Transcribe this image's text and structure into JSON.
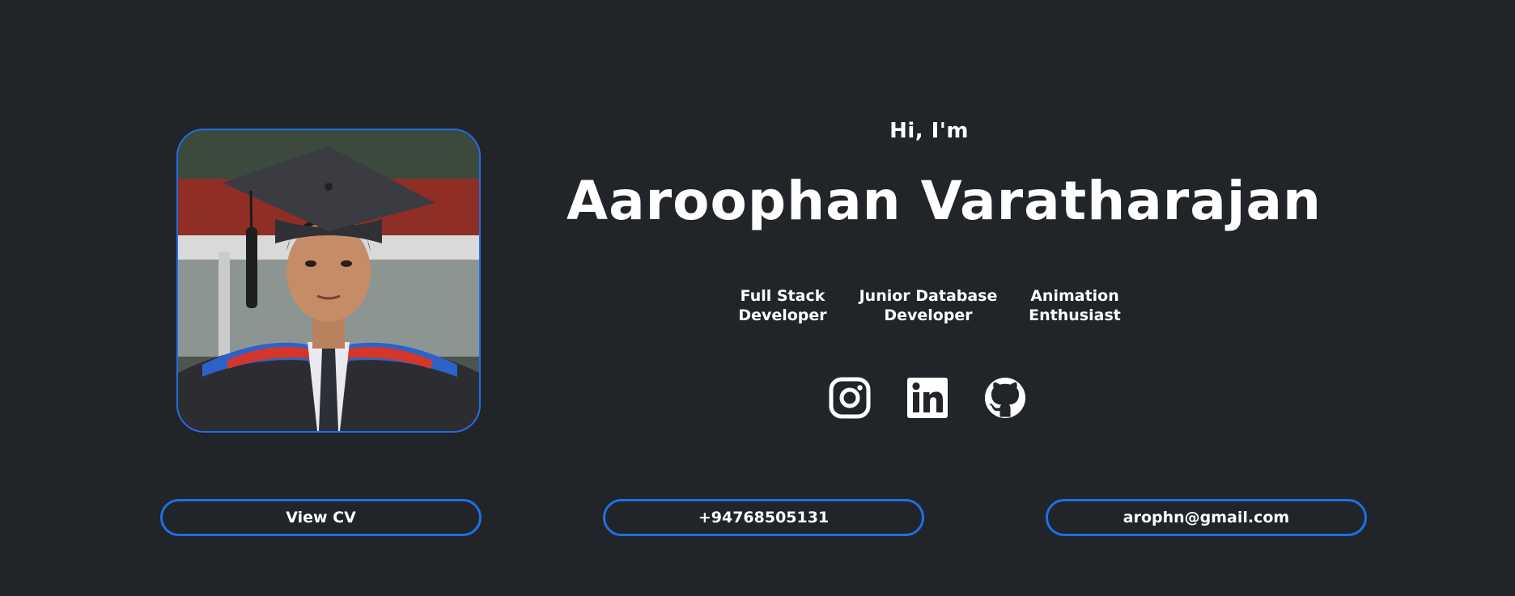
{
  "intro": {
    "greeting": "Hi, I'm",
    "name": "Aaroophan Varatharajan"
  },
  "roles": [
    {
      "line1": "Full Stack",
      "line2": "Developer"
    },
    {
      "line1": "Junior Database",
      "line2": "Developer"
    },
    {
      "line1": "Animation",
      "line2": "Enthusiast"
    }
  ],
  "socials": [
    {
      "icon": "instagram-icon"
    },
    {
      "icon": "linkedin-icon"
    },
    {
      "icon": "github-icon"
    }
  ],
  "buttons": {
    "cv": "View CV",
    "phone": "+94768505131",
    "email": "arophn@gmail.com"
  },
  "colors": {
    "background": "#212429",
    "accent": "#1f6fe3",
    "text": "#ffffff"
  }
}
